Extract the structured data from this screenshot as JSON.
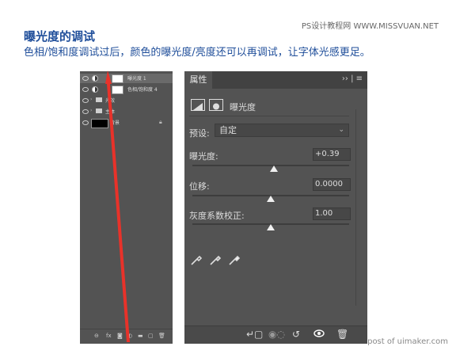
{
  "watermark": "PS设计教程网 WWW.MISSVUAN.NET",
  "heading": "曝光度的调试",
  "subheading": "色相/饱和度调试过后，颜色的曝光度/亮度还可以再调试，让字体光感更足。",
  "bottom_watermark": "post of uimaker.com",
  "layers": [
    {
      "name": "曝光度 1",
      "type": "adjustment",
      "selected": true
    },
    {
      "name": "色相/饱和度 4",
      "type": "adjustment",
      "selected": false
    },
    {
      "name": "光效",
      "type": "group",
      "selected": false
    },
    {
      "name": "主体",
      "type": "group",
      "selected": false
    },
    {
      "name": "背景",
      "type": "background",
      "selected": false
    }
  ],
  "layers_footer_icons": [
    "link-icon",
    "fx-icon",
    "mask-icon",
    "adjustment-icon",
    "folder-icon",
    "new-layer-icon",
    "trash-icon"
  ],
  "properties": {
    "tab": "属性",
    "title": "曝光度",
    "preset_label": "预设:",
    "preset_value": "自定",
    "exposure_label": "曝光度:",
    "exposure_value": "+0.39",
    "exposure_level": 0.52,
    "offset_label": "位移:",
    "offset_value": "0.0000",
    "offset_level": 0.5,
    "gamma_label": "灰度系数校正:",
    "gamma_value": "1.00",
    "gamma_level": 0.5
  },
  "accent_color": "#1f4e9a",
  "arrow_color": "#e8322a"
}
